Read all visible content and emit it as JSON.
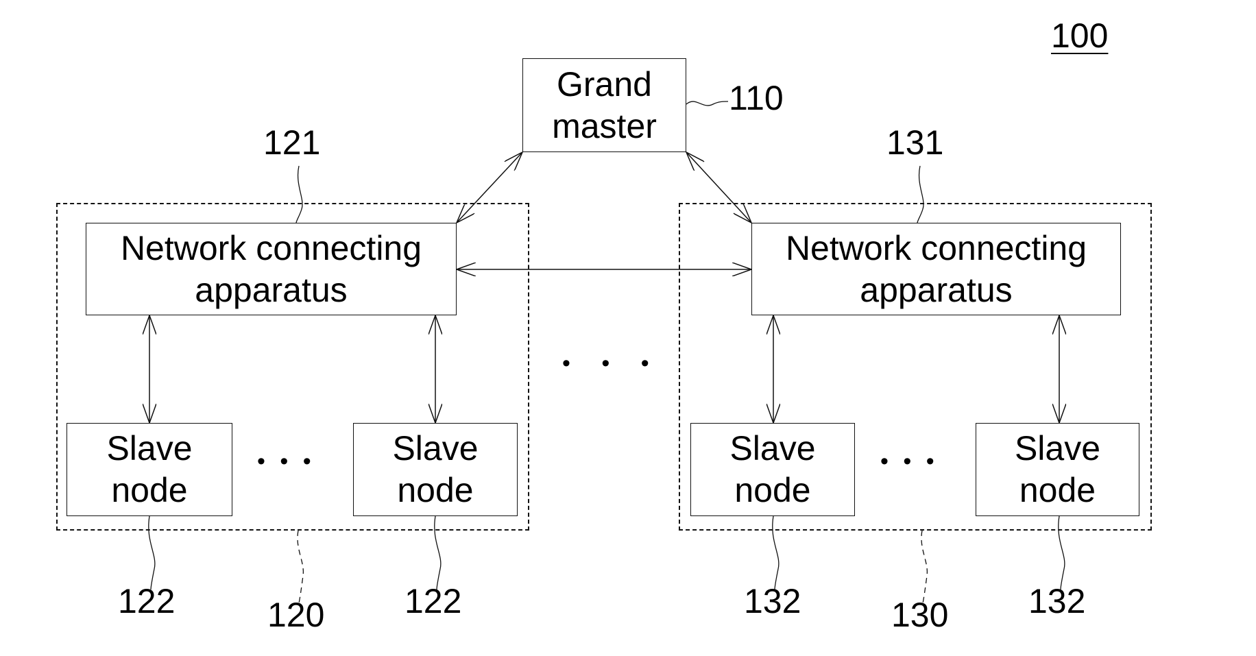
{
  "figure": {
    "reference": "100"
  },
  "grand_master": {
    "label_line1": "Grand",
    "label_line2": "master",
    "reference": "110"
  },
  "groups": [
    {
      "reference": "120",
      "nca": {
        "label_line1": "Network connecting",
        "label_line2": "apparatus",
        "reference": "121"
      },
      "slaves": [
        {
          "label_line1": "Slave",
          "label_line2": "node",
          "reference": "122"
        },
        {
          "label_line1": "Slave",
          "label_line2": "node",
          "reference": "122"
        }
      ],
      "ellipsis": "• • •"
    },
    {
      "reference": "130",
      "nca": {
        "label_line1": "Network connecting",
        "label_line2": "apparatus",
        "reference": "131"
      },
      "slaves": [
        {
          "label_line1": "Slave",
          "label_line2": "node",
          "reference": "132"
        },
        {
          "label_line1": "Slave",
          "label_line2": "node",
          "reference": "132"
        }
      ],
      "ellipsis": "• • •"
    }
  ],
  "middle_ellipsis": "• • •"
}
